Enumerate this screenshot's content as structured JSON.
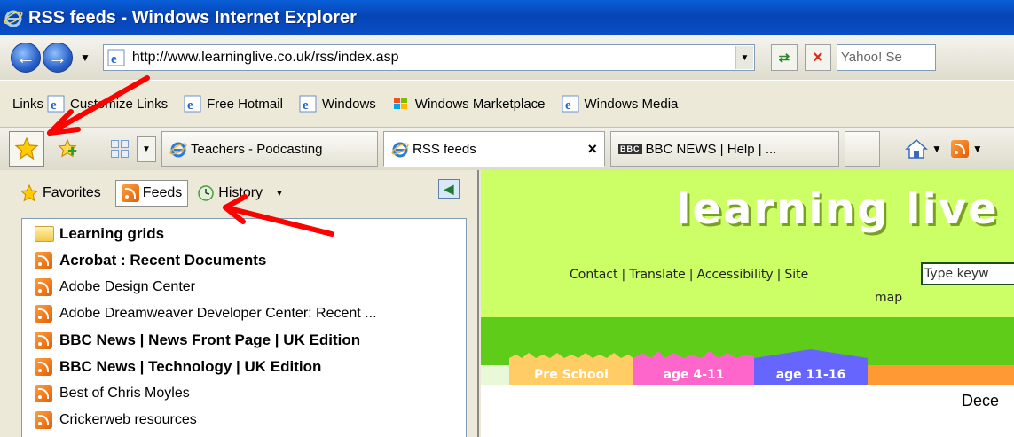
{
  "window": {
    "title": "RSS feeds - Windows Internet Explorer"
  },
  "address_bar": {
    "url": "http://www.learninglive.co.uk/rss/index.asp",
    "search_placeholder": "Yahoo! Se"
  },
  "links_bar": {
    "label": "Links",
    "items": [
      "Customize Links",
      "Free Hotmail",
      "Windows",
      "Windows Marketplace",
      "Windows Media"
    ]
  },
  "tabs": {
    "items": [
      {
        "label": "Teachers - Podcasting",
        "active": false
      },
      {
        "label": "RSS feeds",
        "active": true
      },
      {
        "label": "BBC NEWS | Help | ...",
        "active": false,
        "badge": "BBC"
      }
    ]
  },
  "favorites_center": {
    "favorites_label": "Favorites",
    "feeds_label": "Feeds",
    "history_label": "History",
    "items": [
      {
        "label": "Learning grids",
        "type": "folder",
        "bold": true
      },
      {
        "label": "Acrobat : Recent Documents",
        "type": "feed",
        "bold": true
      },
      {
        "label": "Adobe Design Center",
        "type": "feed",
        "bold": false
      },
      {
        "label": "Adobe Dreamweaver Developer Center: Recent ...",
        "type": "feed",
        "bold": false
      },
      {
        "label": "BBC News | News Front Page | UK Edition",
        "type": "feed",
        "bold": true
      },
      {
        "label": "BBC News | Technology | UK Edition",
        "type": "feed",
        "bold": true
      },
      {
        "label": "Best of Chris Moyles",
        "type": "feed",
        "bold": false
      },
      {
        "label": "Crickerweb resources",
        "type": "feed",
        "bold": false
      }
    ]
  },
  "web_page": {
    "logo": "learning live",
    "top_links": [
      "Contact",
      "Translate",
      "Accessibility",
      "Site"
    ],
    "site_map_tail": "map",
    "keyword_placeholder": "Type keyw",
    "age_tabs": [
      {
        "label": "Pre School",
        "color": "#ffcc66"
      },
      {
        "label": "age 4-11",
        "color": "#ff66cc"
      },
      {
        "label": "age 11-16",
        "color": "#6666ff"
      }
    ],
    "date_fragment": "Dece"
  },
  "colors": {
    "annotation_arrow": "#ff0000",
    "page_green": "#ccff66",
    "band_green": "#5fcc1a"
  }
}
